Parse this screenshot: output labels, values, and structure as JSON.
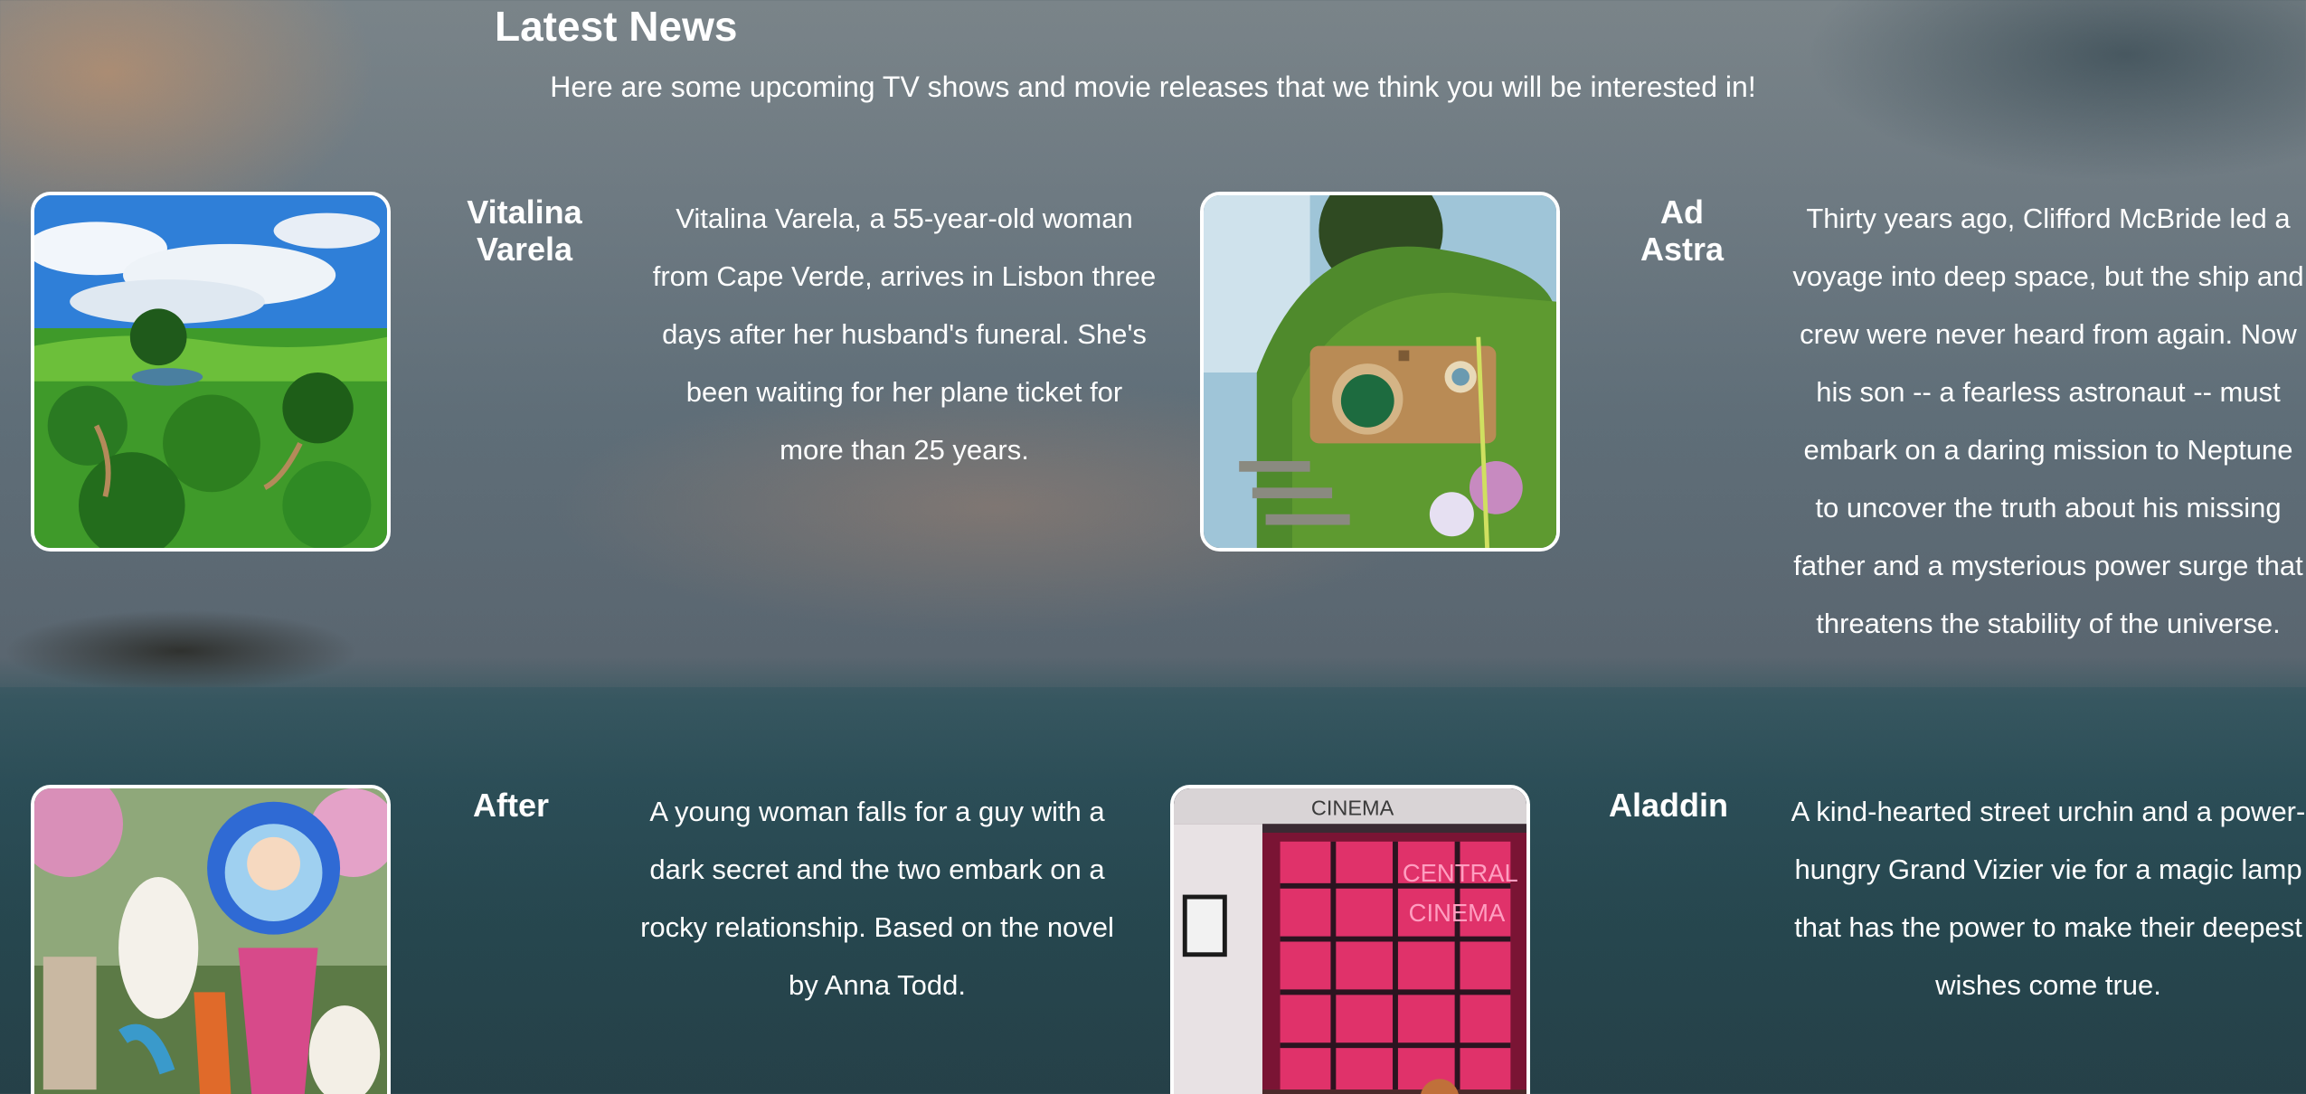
{
  "section": {
    "title": "Latest News",
    "intro": "Here are some upcoming TV shows and movie releases that we think you will be interested in!"
  },
  "items": [
    {
      "title_line1": "Vitalina",
      "title_line2": "Varela",
      "description": "Vitalina Varela, a 55-year-old woman from Cape Verde, arrives in Lisbon three days after her husband's funeral. She's been waiting for her plane ticket for more than 25 years."
    },
    {
      "title_line1": "Ad",
      "title_line2": "Astra",
      "description": "Thirty years ago, Clifford McBride led a voyage into deep space, but the ship and crew were never heard from again. Now his son -- a fearless astronaut -- must embark on a daring mission to Neptune to uncover the truth about his missing father and a mysterious power surge that threatens the stability of the universe."
    },
    {
      "title_line1": "After",
      "description": "A young woman falls for a guy with a dark secret and the two embark on a rocky relationship. Based on the novel by Anna Todd."
    },
    {
      "title_line1": "Aladdin",
      "description": "A kind-hearted street urchin and a power-hungry Grand Vizier vie for a magic lamp that has the power to make their deepest wishes come true."
    }
  ],
  "images": {
    "cinema_sign": "CINEMA",
    "neon_line1": "CENTRAL",
    "neon_line2": "CINEMA"
  }
}
